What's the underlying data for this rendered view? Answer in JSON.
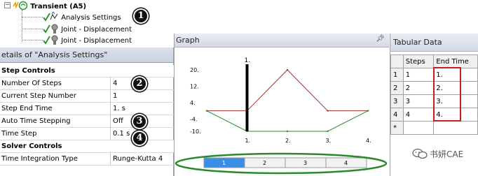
{
  "tree": {
    "root_label": "Transient (A5)",
    "items": [
      {
        "label": "Analysis Settings"
      },
      {
        "label": "Joint - Displacement"
      },
      {
        "label": "Joint - Displacement"
      }
    ]
  },
  "callouts": [
    "1",
    "2",
    "3",
    "4"
  ],
  "details": {
    "title": "etails of \"Analysis Settings\"",
    "rows": [
      {
        "type": "section",
        "label": "Step Controls"
      },
      {
        "type": "prop",
        "label": "Number Of Steps",
        "value": "4"
      },
      {
        "type": "prop",
        "label": "Current Step Number",
        "value": "1"
      },
      {
        "type": "prop",
        "label": "Step End Time",
        "value": "1. s"
      },
      {
        "type": "prop",
        "label": "Auto Time Stepping",
        "value": "Off"
      },
      {
        "type": "prop",
        "label": "Time Step",
        "value": "0.1 s"
      },
      {
        "type": "section",
        "label": "Solver Controls"
      },
      {
        "type": "prop",
        "label": "Time Integration Type",
        "value": "Runge-Kutta 4"
      }
    ]
  },
  "graph": {
    "title": "Graph",
    "pin_icon": "pin-icon",
    "top_marker": "1.",
    "y_ticks": [
      "20.",
      "12.",
      "4.",
      "-4.",
      "-10."
    ],
    "x_ticks": [
      "1.",
      "2.",
      "3.",
      "4."
    ],
    "step_buttons": [
      "1",
      "2",
      "3",
      "4"
    ],
    "colors": {
      "red_series": "#a03030",
      "green_series": "#2e8b2e",
      "active_step": "#3a8ee6",
      "ellipse": "#2a8a2a"
    }
  },
  "chart_data": {
    "type": "line",
    "x": [
      0,
      1,
      2,
      3,
      4
    ],
    "xlim": [
      0,
      4
    ],
    "ylim": [
      -10,
      20
    ],
    "series": [
      {
        "values": [
          0,
          0,
          20,
          0,
          0
        ],
        "color": "#a03030"
      },
      {
        "values": [
          0,
          -10,
          -10,
          -10,
          0
        ],
        "color": "#2e8b2e"
      }
    ],
    "current_time": 1
  },
  "tabular": {
    "title": "Tabular Data",
    "columns": [
      "Steps",
      "End Time"
    ],
    "rows": [
      {
        "index": "1",
        "steps": "1",
        "end_time": "1."
      },
      {
        "index": "2",
        "steps": "2",
        "end_time": "2."
      },
      {
        "index": "3",
        "steps": "3",
        "end_time": "3."
      },
      {
        "index": "4",
        "steps": "4",
        "end_time": "4."
      }
    ],
    "new_row_marker": "*"
  },
  "watermark": "书妍CAE"
}
